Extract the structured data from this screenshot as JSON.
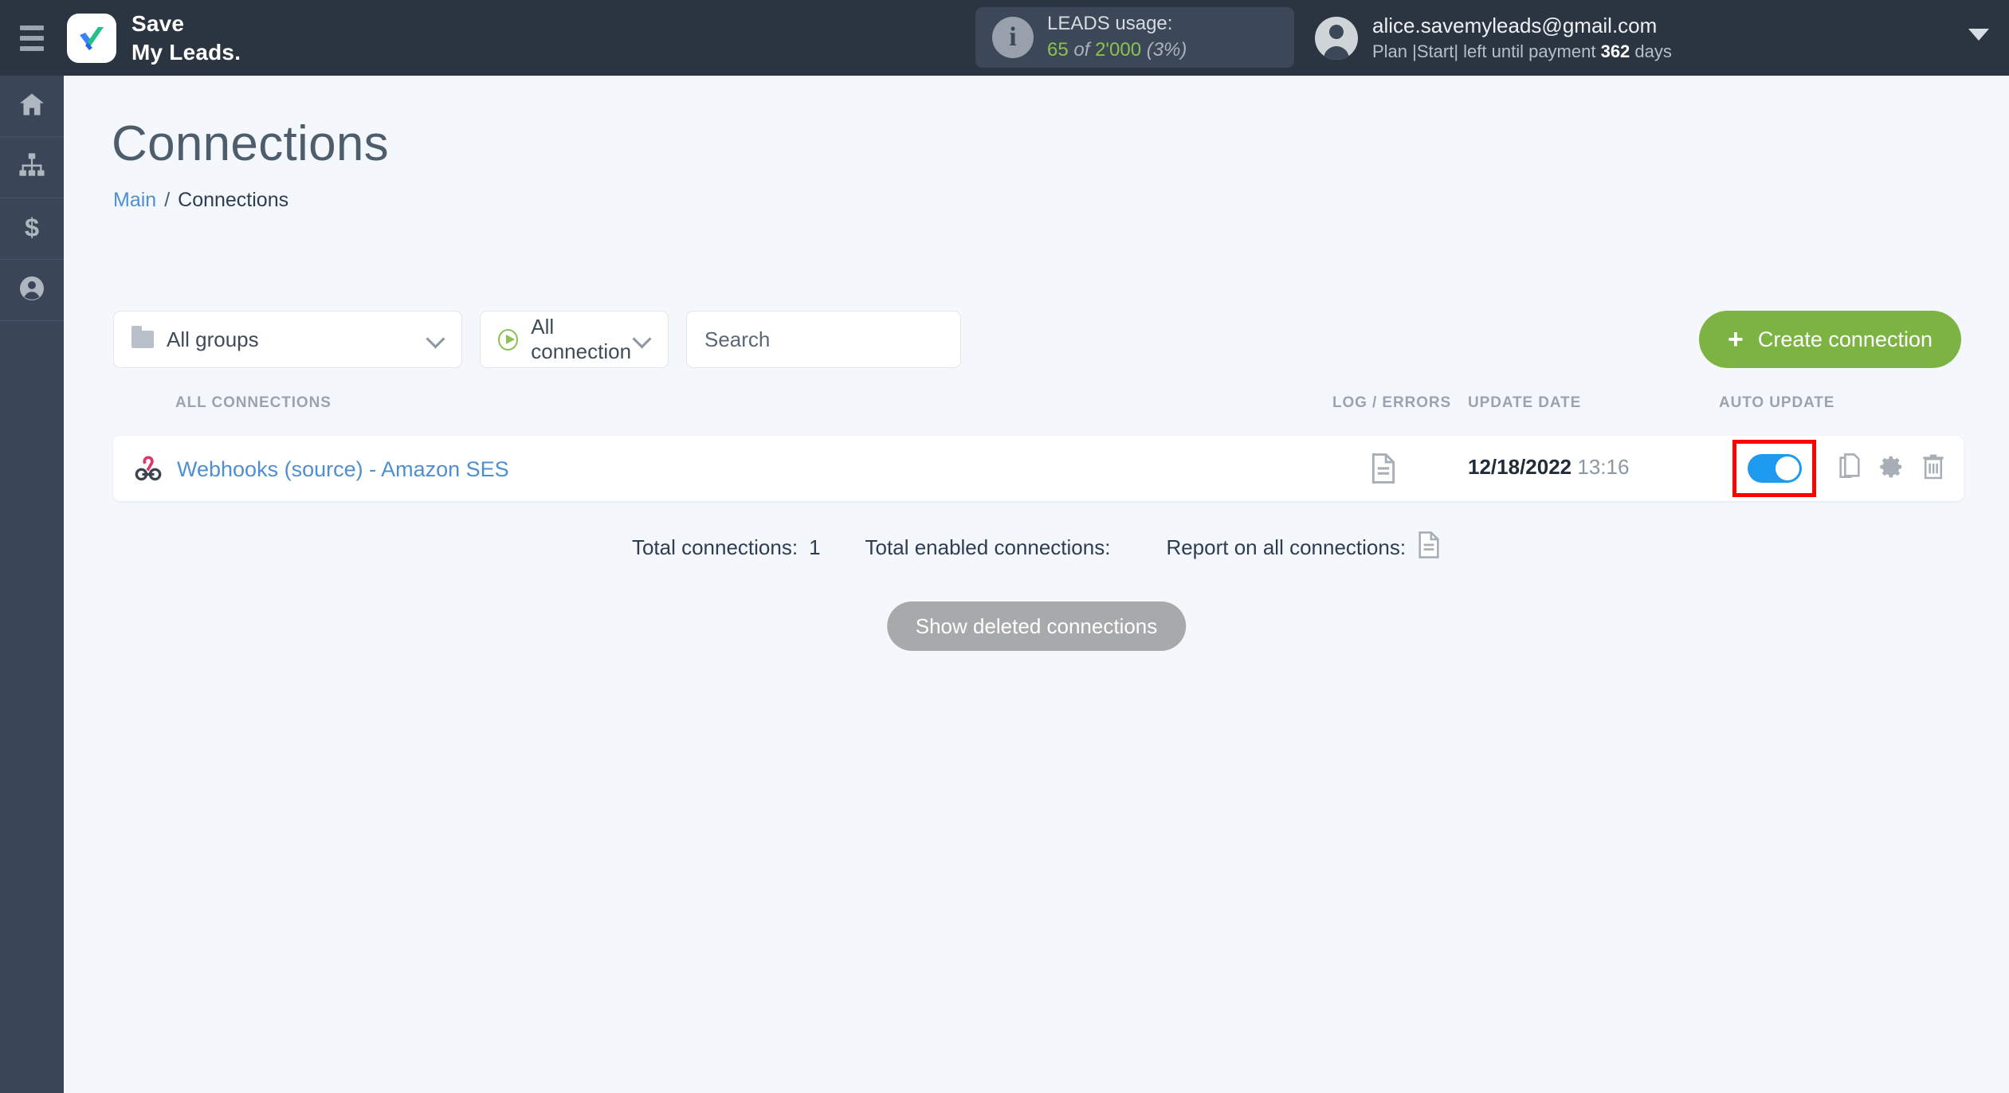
{
  "topbar": {
    "menu_icon": "hamburger-icon",
    "brand_line1": "Save",
    "brand_line2": "My Leads.",
    "usage": {
      "info_glyph": "i",
      "title": "LEADS usage:",
      "used": "65",
      "of": " of ",
      "total": "2'000",
      "percent": "(3%)"
    },
    "account": {
      "email": "alice.savemyleads@gmail.com",
      "plan_prefix": "Plan |Start| left until payment ",
      "plan_days": "362",
      "plan_suffix": " days",
      "caret": "chevron-down-icon"
    }
  },
  "sidebar": {
    "items": [
      {
        "name": "home",
        "icon": "home-icon"
      },
      {
        "name": "connections",
        "icon": "sitemap-icon"
      },
      {
        "name": "billing",
        "icon": "dollar-icon"
      },
      {
        "name": "account",
        "icon": "user-circle-icon"
      }
    ]
  },
  "page": {
    "title": "Connections",
    "breadcrumb": {
      "root": "Main",
      "separator": "/",
      "current": "Connections"
    }
  },
  "filters": {
    "group_select": {
      "label": "All groups",
      "icon": "folder-icon"
    },
    "connection_select": {
      "label": "All connection",
      "icon": "play-circle-icon"
    },
    "search_placeholder": "Search",
    "search_value": ""
  },
  "create_button": {
    "label": "Create connection",
    "plus": "+",
    "color": "#7cb342"
  },
  "table": {
    "headers": {
      "connections": "ALL CONNECTIONS",
      "log_errors": "LOG / ERRORS",
      "update_date": "UPDATE DATE",
      "auto_update": "AUTO UPDATE"
    },
    "rows": [
      {
        "icon": "webhook-icon",
        "name": "Webhooks (source) - Amazon SES",
        "log_icon": "document-icon",
        "date": "12/18/2022",
        "time": "13:16",
        "auto_update_enabled": true,
        "actions": [
          "copy-icon",
          "gear-icon",
          "trash-icon"
        ]
      }
    ]
  },
  "footer": {
    "total_connections_label": "Total connections:",
    "total_connections_value": "1",
    "total_enabled_label": "Total enabled connections:",
    "total_enabled_value": "",
    "report_label": "Report on all connections:",
    "report_icon": "document-icon",
    "show_deleted_label": "Show deleted connections"
  },
  "highlight": {
    "color": "#ff0000",
    "target": "auto-update-toggle"
  }
}
